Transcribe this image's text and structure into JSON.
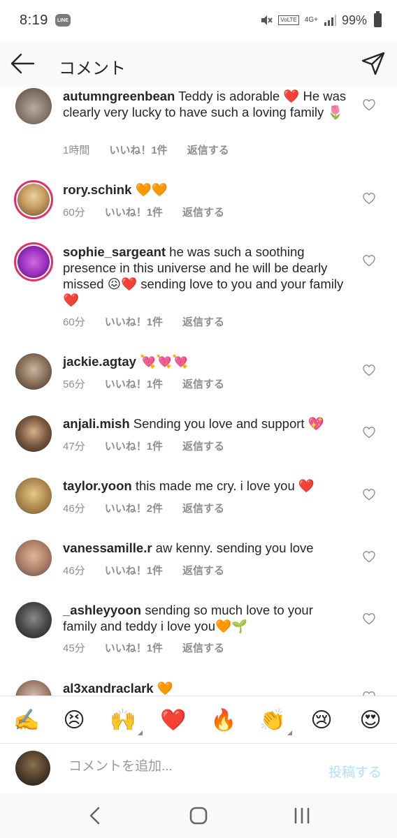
{
  "status": {
    "time": "8:19",
    "line_badge": "LINE",
    "volte": "VoLTE",
    "network": "4G+",
    "battery": "99%"
  },
  "header": {
    "title": "コメント"
  },
  "comments": [
    {
      "user": "autumngreenbean",
      "text": "Teddy is adorable ❤️ He was clearly very lucky to have such a loving family 🌷",
      "time": "1時間",
      "likes": "いいね！1件",
      "reply": "返信する"
    },
    {
      "user": "rory.schink",
      "text": "🧡🧡",
      "time": "60分",
      "likes": "いいね！1件",
      "reply": "返信する"
    },
    {
      "user": "sophie_sargeant",
      "text": "he was such a soothing presence in this universe and he will be dearly missed 😖❤️ sending love to you and your family ❤️",
      "time": "60分",
      "likes": "いいね！1件",
      "reply": "返信する"
    },
    {
      "user": "jackie.agtay",
      "text": "💘💘💘",
      "time": "56分",
      "likes": "いいね！1件",
      "reply": "返信する"
    },
    {
      "user": "anjali.mish",
      "text": "Sending you love and support 💖",
      "time": "47分",
      "likes": "いいね！1件",
      "reply": "返信する"
    },
    {
      "user": "taylor.yoon",
      "text": "this made me cry. i love you ❤️",
      "time": "46分",
      "likes": "いいね！2件",
      "reply": "返信する"
    },
    {
      "user": "vanessamille.r",
      "text": "aw kenny. sending you love",
      "time": "46分",
      "likes": "いいね！1件",
      "reply": "返信する"
    },
    {
      "user": "_ashleyyoon",
      "text": "sending so much love to your family and teddy i love you🧡🌱",
      "time": "45分",
      "likes": "いいね！1件",
      "reply": "返信する"
    },
    {
      "user": "al3xandraclark",
      "text": "🧡"
    }
  ],
  "emoji_bar": [
    "✍️",
    "😣",
    "🙌",
    "❤️",
    "🔥",
    "👏",
    "😢",
    "😍"
  ],
  "input": {
    "placeholder": "コメントを追加...",
    "post_label": "投稿する"
  },
  "colors": {
    "accent_disabled": "#b2dffc",
    "meta_gray": "#8e8e8e",
    "story_ring": "#e1306c"
  }
}
